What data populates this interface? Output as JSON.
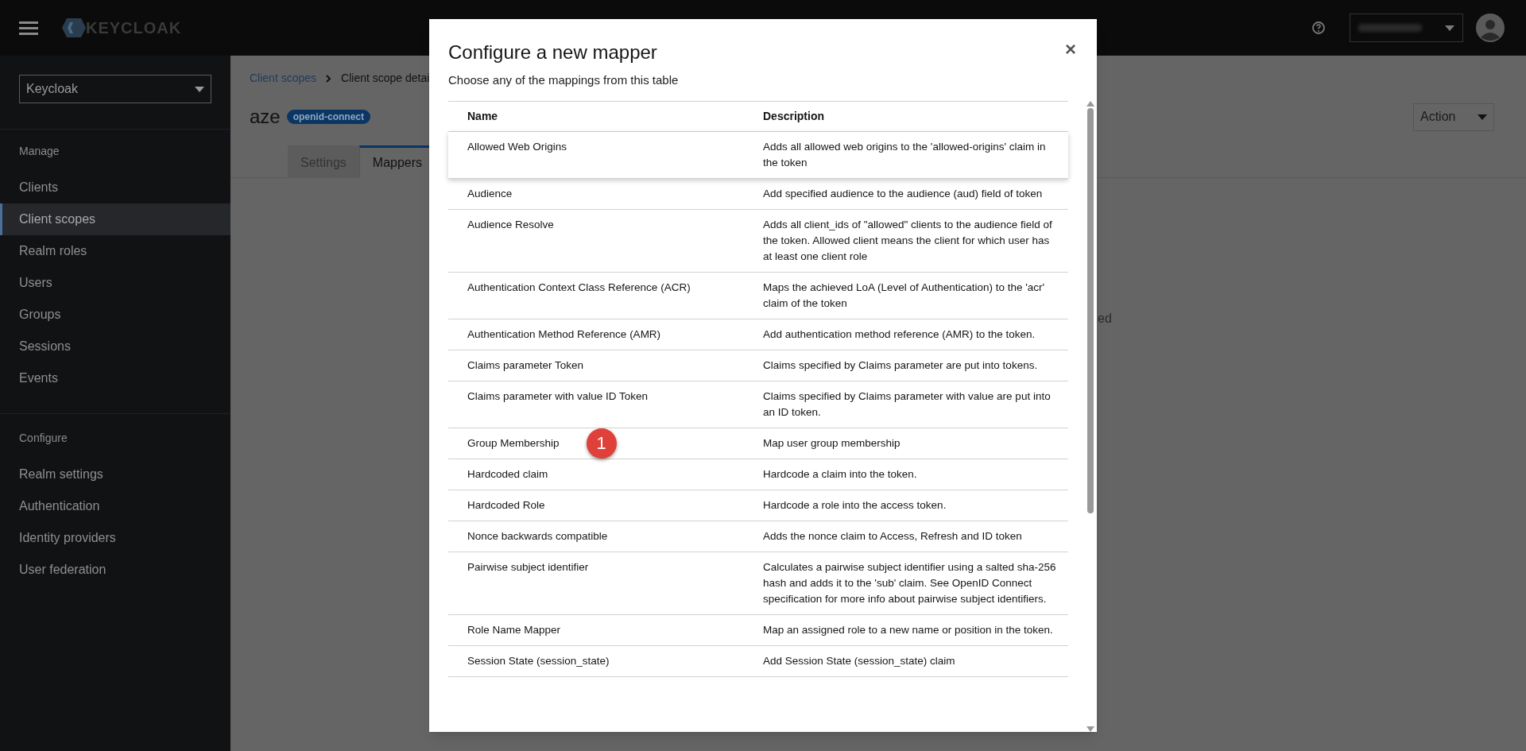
{
  "masthead": {
    "logo": "KEYCLOAK"
  },
  "sidebar": {
    "realm": "Keycloak",
    "sections": [
      {
        "title": "Manage",
        "items": [
          {
            "label": "Clients",
            "selected": false
          },
          {
            "label": "Client scopes",
            "selected": true
          },
          {
            "label": "Realm roles",
            "selected": false
          },
          {
            "label": "Users",
            "selected": false
          },
          {
            "label": "Groups",
            "selected": false
          },
          {
            "label": "Sessions",
            "selected": false
          },
          {
            "label": "Events",
            "selected": false
          }
        ]
      },
      {
        "title": "Configure",
        "items": [
          {
            "label": "Realm settings",
            "selected": false
          },
          {
            "label": "Authentication",
            "selected": false
          },
          {
            "label": "Identity providers",
            "selected": false
          },
          {
            "label": "User federation",
            "selected": false
          }
        ]
      }
    ]
  },
  "breadcrumb": [
    "Client scopes",
    "Client scope detai"
  ],
  "page": {
    "title": "aze",
    "badge": "openid-connect",
    "action": "Action",
    "empty_text": "ed"
  },
  "tabs": [
    {
      "label": "Settings",
      "selected": false
    },
    {
      "label": "Mappers",
      "selected": true
    }
  ],
  "modal": {
    "title": "Configure a new mapper",
    "close": "×",
    "subtitle": "Choose any of the mappings from this table",
    "columns": [
      "Name",
      "Description"
    ],
    "rows": [
      {
        "name": "Allowed Web Origins",
        "description": "Adds all allowed web origins to the 'allowed-origins' claim in the token",
        "highlighted": true
      },
      {
        "name": "Audience",
        "description": "Add specified audience to the audience (aud) field of token",
        "highlighted": false
      },
      {
        "name": "Audience Resolve",
        "description": "Adds all client_ids of \"allowed\" clients to the audience field of the token. Allowed client means the client for which user has at least one client role",
        "highlighted": false
      },
      {
        "name": "Authentication Context Class Reference (ACR)",
        "description": "Maps the achieved LoA (Level of Authentication) to the 'acr' claim of the token",
        "highlighted": false
      },
      {
        "name": "Authentication Method Reference (AMR)",
        "description": "Add authentication method reference (AMR) to the token.",
        "highlighted": false
      },
      {
        "name": "Claims parameter Token",
        "description": "Claims specified by Claims parameter are put into tokens.",
        "highlighted": false
      },
      {
        "name": "Claims parameter with value ID Token",
        "description": "Claims specified by Claims parameter with value are put into an ID token.",
        "highlighted": false
      },
      {
        "name": "Group Membership",
        "description": "Map user group membership",
        "highlighted": false,
        "callout": "1"
      },
      {
        "name": "Hardcoded claim",
        "description": "Hardcode a claim into the token.",
        "highlighted": false
      },
      {
        "name": "Hardcoded Role",
        "description": "Hardcode a role into the access token.",
        "highlighted": false
      },
      {
        "name": "Nonce backwards compatible",
        "description": "Adds the nonce claim to Access, Refresh and ID token",
        "highlighted": false
      },
      {
        "name": "Pairwise subject identifier",
        "description": "Calculates a pairwise subject identifier using a salted sha-256 hash and adds it to the 'sub' claim. See OpenID Connect specification for more info about pairwise subject identifiers.",
        "highlighted": false
      },
      {
        "name": "Role Name Mapper",
        "description": "Map an assigned role to a new name or position in the token.",
        "highlighted": false
      },
      {
        "name": "Session State (session_state)",
        "description": "Add Session State (session_state) claim",
        "highlighted": false
      }
    ]
  }
}
